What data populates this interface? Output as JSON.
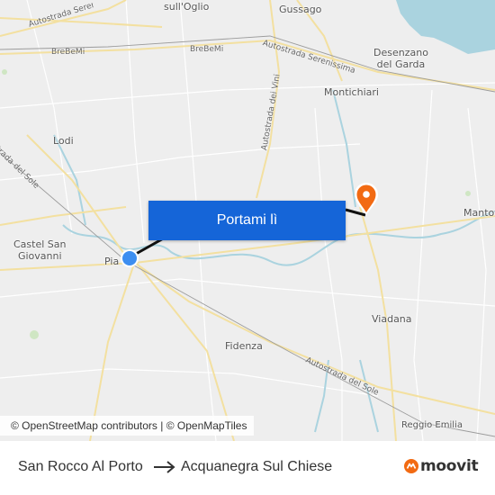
{
  "map": {
    "places": [
      {
        "id": "sull-oglio",
        "text": "sull'Oglio"
      },
      {
        "id": "gussago",
        "text": "Gussago"
      },
      {
        "id": "desenzano",
        "text": "Desenzano\ndel Garda"
      },
      {
        "id": "montichiari",
        "text": "Montichiari"
      },
      {
        "id": "lodi",
        "text": "Lodi"
      },
      {
        "id": "castel-san-giovanni",
        "text": "Castel San\nGiovanni"
      },
      {
        "id": "piacenza",
        "text": "Piacenza"
      },
      {
        "id": "viadana",
        "text": "Viadana"
      },
      {
        "id": "fidenza",
        "text": "Fidenza"
      },
      {
        "id": "mantova",
        "text": "Mantova"
      },
      {
        "id": "reggio-emilia",
        "text": "Reggio Emilia"
      }
    ],
    "roads": [
      {
        "id": "a4-west",
        "text": "Autostrada Seren"
      },
      {
        "id": "brebemi-1",
        "text": "BreBeMi"
      },
      {
        "id": "brebemi-2",
        "text": "BreBeMi"
      },
      {
        "id": "a4-east",
        "text": "Autostrada Serenissima"
      },
      {
        "id": "vini",
        "text": "Autostrada dei Vini"
      },
      {
        "id": "a1-north",
        "text": "Autostrada del Sole"
      },
      {
        "id": "a1-south",
        "text": "Autostrada del Sole"
      }
    ],
    "colors": {
      "background": "#eeeeee",
      "water": "#aad3df",
      "road": "#f3e0a0",
      "route": "#111111",
      "accent": "#1565d8",
      "pin": "#f26a12"
    }
  },
  "cta": {
    "label": "Portami lì"
  },
  "attribution": {
    "text": "© OpenStreetMap contributors | © OpenMapTiles"
  },
  "route": {
    "from": "San Rocco Al Porto",
    "to": "Acquanegra Sul Chiese",
    "arrow_icon": "arrow-right-icon"
  },
  "brand": {
    "name": "moovit",
    "icon": "moovit-logo-icon"
  }
}
